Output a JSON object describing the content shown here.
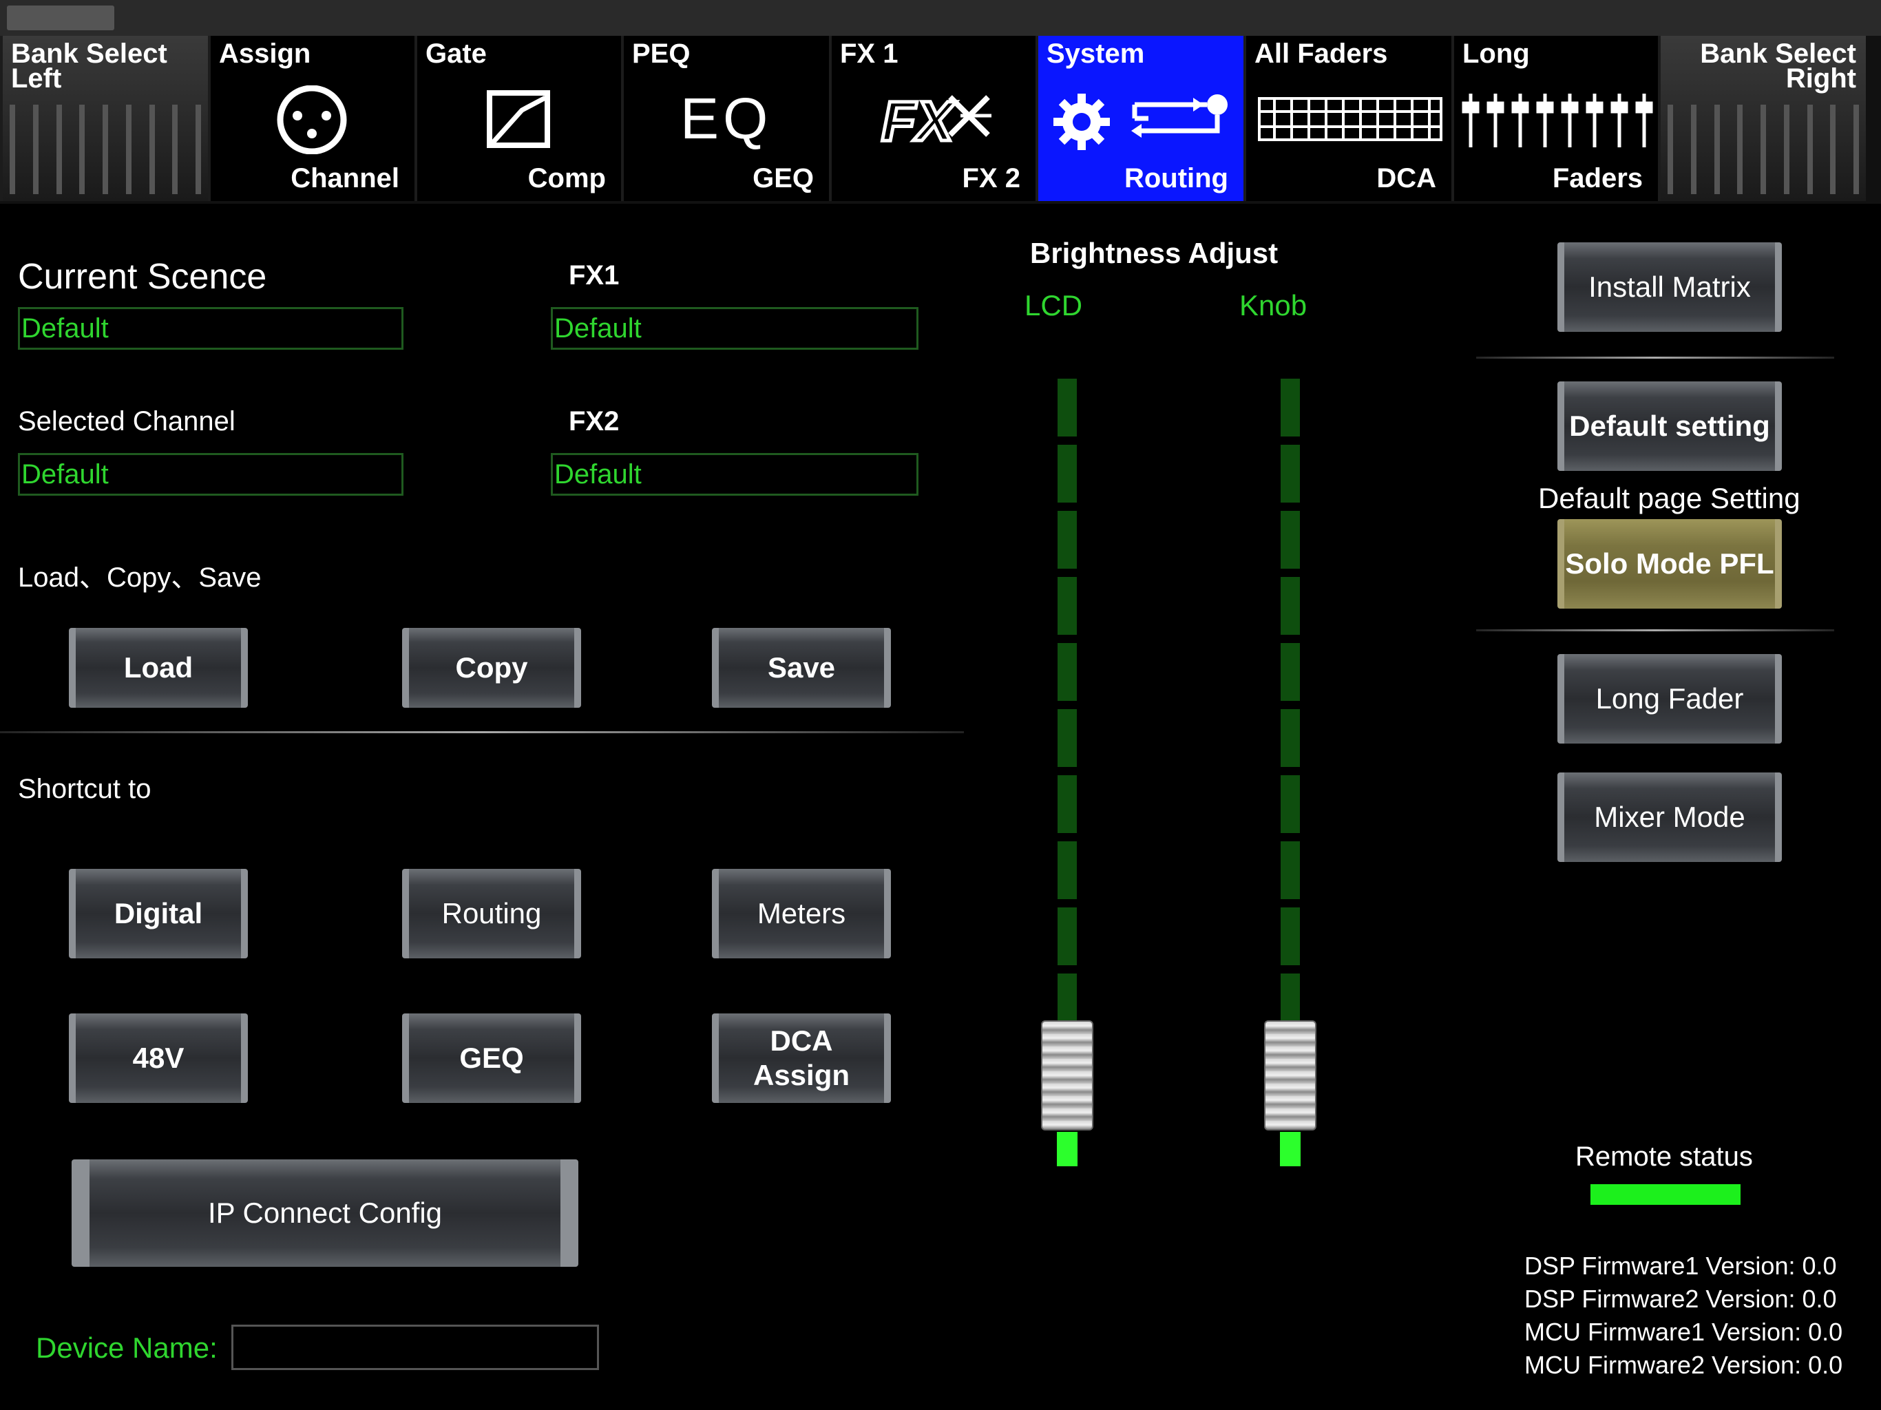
{
  "tabs": [
    {
      "top": "Bank Select\nLeft",
      "bottom": "",
      "icon": "bank-fader-icon"
    },
    {
      "top": "Assign",
      "bottom": "Channel",
      "icon": "xlr-connector-icon"
    },
    {
      "top": "Gate",
      "bottom": "Comp",
      "icon": "compressor-curve-icon"
    },
    {
      "top": "PEQ",
      "bottom": "GEQ",
      "icon": "eq-text-icon",
      "icon_text": "EQ"
    },
    {
      "top": "FX 1",
      "bottom": "FX 2",
      "icon": "fx-logo-icon",
      "icon_text": "FX"
    },
    {
      "top": "System",
      "bottom": "Routing",
      "icon": "gear-routing-icon"
    },
    {
      "top": "All Faders",
      "bottom": "DCA",
      "icon": "dca-grid-icon"
    },
    {
      "top": "Long",
      "bottom": "Faders",
      "icon": "faders-icon"
    },
    {
      "top": "Bank Select\nRight",
      "bottom": "",
      "icon": "bank-fader-icon"
    }
  ],
  "scene": {
    "current_label": "Current Scence",
    "current_value": "Default",
    "fx1_label": "FX1",
    "fx1_value": "Default",
    "selected_channel_label": "Selected Channel",
    "selected_channel_value": "Default",
    "fx2_label": "FX2",
    "fx2_value": "Default"
  },
  "lcs": {
    "label": "Load、Copy、Save",
    "load": "Load",
    "copy": "Copy",
    "save": "Save"
  },
  "shortcut": {
    "label": "Shortcut to",
    "digital": "Digital",
    "routing": "Routing",
    "meters": "Meters",
    "v48": "48V",
    "geq": "GEQ",
    "dca_assign": "DCA\nAssign",
    "ip_config": "IP Connect Config"
  },
  "device": {
    "label": "Device Name:",
    "value": ""
  },
  "brightness": {
    "title": "Brightness Adjust",
    "lcd_label": "LCD",
    "knob_label": "Knob",
    "lcd_level": 0.0,
    "knob_level": 0.0
  },
  "right": {
    "install_matrix": "Install Matrix",
    "default_setting": "Default setting",
    "default_page_label": "Default page Setting",
    "solo_mode": "Solo Mode PFL",
    "long_fader": "Long Fader",
    "mixer_mode": "Mixer Mode",
    "remote_status": "Remote status"
  },
  "firmware": [
    "DSP Firmware1 Version: 0.0",
    "DSP Firmware2 Version: 0.0",
    "MCU Firmware1 Version: 0.0",
    "MCU Firmware2 Version: 0.0"
  ],
  "colors": {
    "accent_blue": "#0a16ff",
    "green_text": "#2fd62f",
    "status_green": "#1cf01c",
    "solo_gold": "#7b7440"
  }
}
